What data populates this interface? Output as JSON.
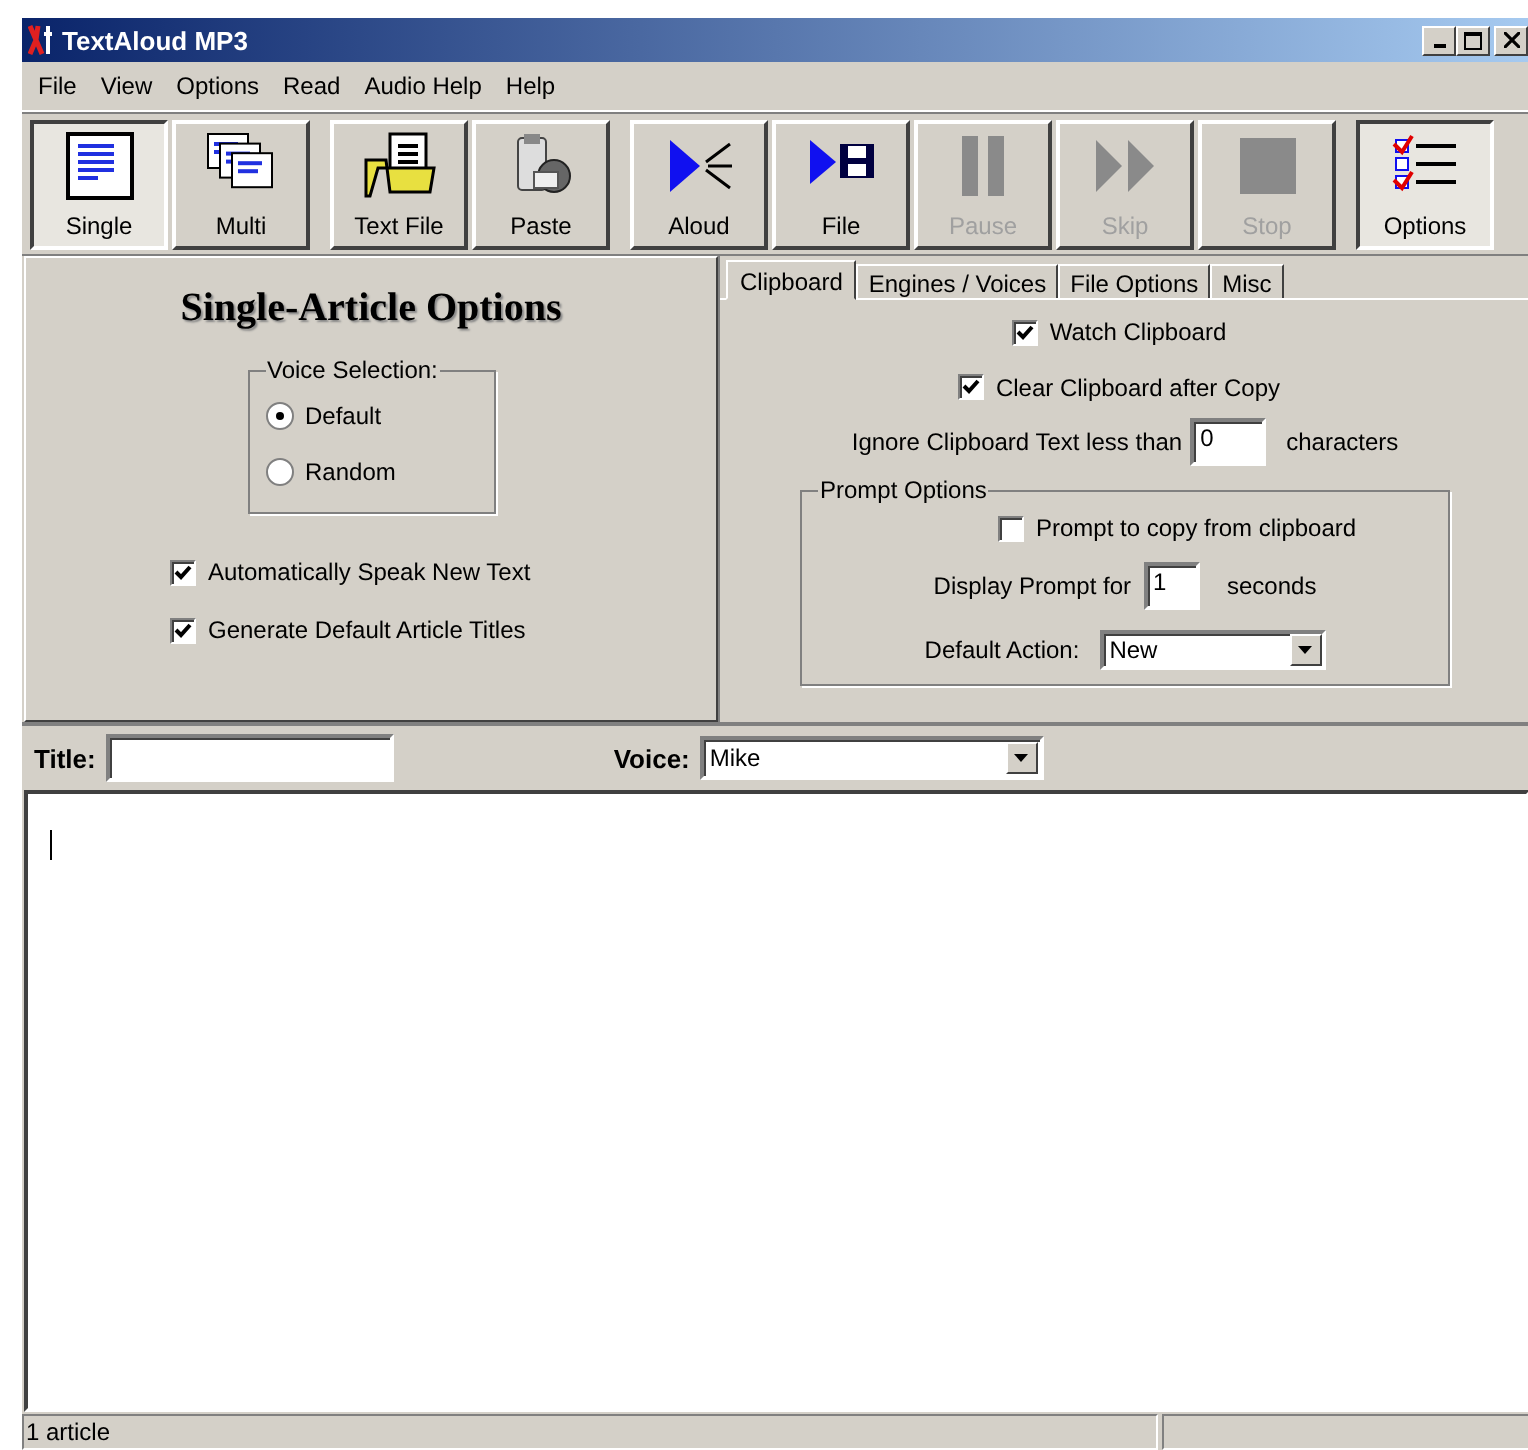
{
  "window": {
    "title": "TextAloud MP3"
  },
  "menu": [
    "File",
    "View",
    "Options",
    "Read",
    "Audio Help",
    "Help"
  ],
  "toolbar": [
    {
      "buttons": [
        {
          "label": "Single",
          "kind": "single",
          "selected": true,
          "disabled": false
        },
        {
          "label": "Multi",
          "kind": "multi",
          "selected": false,
          "disabled": false
        }
      ]
    },
    {
      "buttons": [
        {
          "label": "Text File",
          "kind": "textfile",
          "selected": false,
          "disabled": false
        },
        {
          "label": "Paste",
          "kind": "paste",
          "selected": false,
          "disabled": false
        }
      ]
    },
    {
      "buttons": [
        {
          "label": "Aloud",
          "kind": "aloud",
          "selected": false,
          "disabled": false
        },
        {
          "label": "File",
          "kind": "savefile",
          "selected": false,
          "disabled": false
        },
        {
          "label": "Pause",
          "kind": "pause",
          "selected": false,
          "disabled": true
        },
        {
          "label": "Skip",
          "kind": "skip",
          "selected": false,
          "disabled": true
        },
        {
          "label": "Stop",
          "kind": "stop",
          "selected": false,
          "disabled": true
        }
      ]
    },
    {
      "buttons": [
        {
          "label": "Options",
          "kind": "options",
          "selected": true,
          "disabled": false
        }
      ]
    }
  ],
  "single_article_options": {
    "heading": "Single-Article Options",
    "voice_selection": {
      "label": "Voice Selection:",
      "options": [
        {
          "label": "Default",
          "selected": true
        },
        {
          "label": "Random",
          "selected": false
        }
      ]
    },
    "checkboxes": [
      {
        "label": "Automatically Speak New Text",
        "checked": true
      },
      {
        "label": "Generate Default Article Titles",
        "checked": true
      }
    ]
  },
  "options_tabs": [
    {
      "label": "Clipboard",
      "selected": true
    },
    {
      "label": "Engines / Voices",
      "selected": false
    },
    {
      "label": "File Options",
      "selected": false
    },
    {
      "label": "Misc",
      "selected": false
    }
  ],
  "clipboard": {
    "checkboxes": [
      {
        "label": "Watch Clipboard",
        "checked": true
      },
      {
        "label": "Clear Clipboard after Copy",
        "checked": true
      }
    ],
    "ignore_label": "Ignore Clipboard Text less than",
    "ignore_value": "0",
    "ignore_unit": "characters",
    "prompt_options": {
      "label": "Prompt Options",
      "prompt_copy": {
        "label": "Prompt to copy from clipboard",
        "checked": false
      },
      "display_label": "Display Prompt for",
      "display_value": "1",
      "display_unit": "seconds",
      "default_action_label": "Default Action:",
      "default_action_value": "New"
    }
  },
  "title_field": {
    "label": "Title:"
  },
  "voice_field": {
    "label": "Voice:",
    "value": "Mike"
  },
  "status_bar": [
    "1 article"
  ]
}
